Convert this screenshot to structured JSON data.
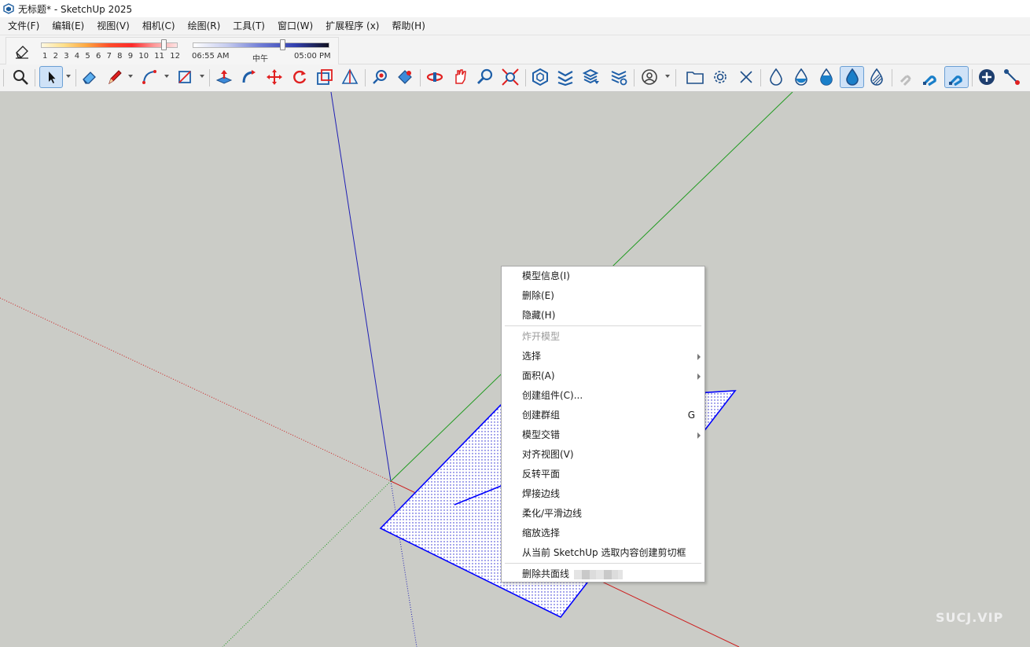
{
  "window": {
    "title": "无标题* - SketchUp 2025"
  },
  "menubar": {
    "items": [
      "文件(F)",
      "编辑(E)",
      "视图(V)",
      "相机(C)",
      "绘图(R)",
      "工具(T)",
      "窗口(W)",
      "扩展程序 (x)",
      "帮助(H)"
    ]
  },
  "shadows": {
    "months": [
      "1",
      "2",
      "3",
      "4",
      "5",
      "6",
      "7",
      "8",
      "9",
      "10",
      "11",
      "12"
    ],
    "month_value": 11,
    "time_start": "06:55 AM",
    "time_mid": "中午",
    "time_end": "05:00 PM",
    "time_value": 0.66
  },
  "toolbar": {
    "icons": [
      "zoom-extents",
      "select",
      "eraser",
      "pencil-line",
      "arc",
      "rectangle",
      "push-pull",
      "follow-me",
      "move",
      "rotate",
      "scale",
      "tape-measure",
      "paint",
      "paint-bucket",
      "orbit",
      "pan",
      "zoom",
      "zoom-window",
      "warehouse",
      "extension-warehouse",
      "layers-send",
      "layers-settings",
      "account",
      "folder",
      "settings",
      "close",
      "drop-outline",
      "drop-half",
      "drop-filled",
      "drop-active",
      "drop-hatched",
      "magnet-disabled",
      "magnet",
      "magnet-active",
      "add-circle",
      "connect-line"
    ]
  },
  "context_menu": {
    "items": [
      {
        "label": "模型信息(I)"
      },
      {
        "label": "删除(E)"
      },
      {
        "label": "隐藏(H)"
      },
      {
        "label": "炸开模型",
        "disabled": true
      },
      {
        "label": "选择",
        "submenu": true
      },
      {
        "label": "面积(A)",
        "submenu": true
      },
      {
        "label": "创建组件(C)..."
      },
      {
        "label": "创建群组",
        "shortcut": "G"
      },
      {
        "label": "模型交错",
        "submenu": true
      },
      {
        "label": "对齐视图(V)"
      },
      {
        "label": "反转平面"
      },
      {
        "label": "焊接边线"
      },
      {
        "label": "柔化/平滑边线"
      },
      {
        "label": "缩放选择"
      },
      {
        "label": "从当前 SketchUp 选取内容创建剪切框"
      },
      {
        "label": "删除共面线"
      }
    ]
  },
  "colors": {
    "viewport_bg": "#cbccc7",
    "axis_red": "#cc1f1f",
    "axis_green": "#1f9a1f",
    "axis_blue": "#1f1fb4",
    "selection_blue": "#0000ff"
  },
  "watermark": "SUCJ.VIP"
}
